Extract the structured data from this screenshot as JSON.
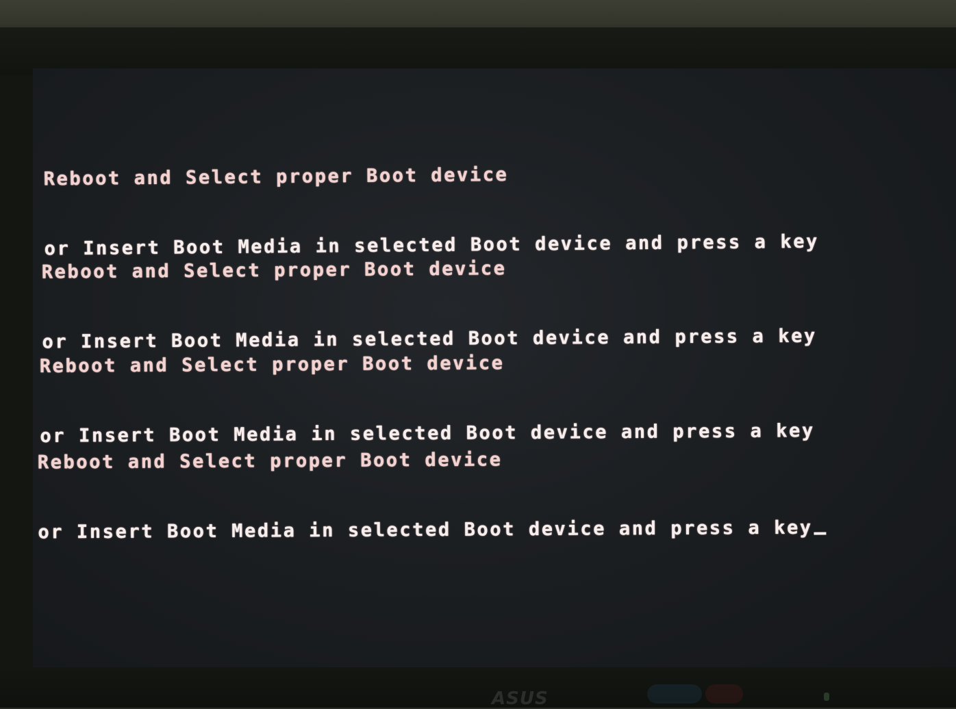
{
  "screen": {
    "type": "BIOS boot error screen (photo of monitor)",
    "messages": [
      {
        "line1": "Reboot and Select proper Boot device",
        "line2": "or Insert Boot Media in selected Boot device and press a key"
      },
      {
        "line1": "Reboot and Select proper Boot device",
        "line2": "or Insert Boot Media in selected Boot device and press a key"
      },
      {
        "line1": "Reboot and Select proper Boot device",
        "line2": "or Insert Boot Media in selected Boot device and press a key"
      },
      {
        "line1": "Reboot and Select proper Boot device",
        "line2": "or Insert Boot Media in selected Boot device and press a key"
      }
    ],
    "cursor": "_",
    "text_color": "#f4e6e4",
    "background_color": "#1e2124"
  },
  "monitor": {
    "brand_logo": "ASUS"
  }
}
